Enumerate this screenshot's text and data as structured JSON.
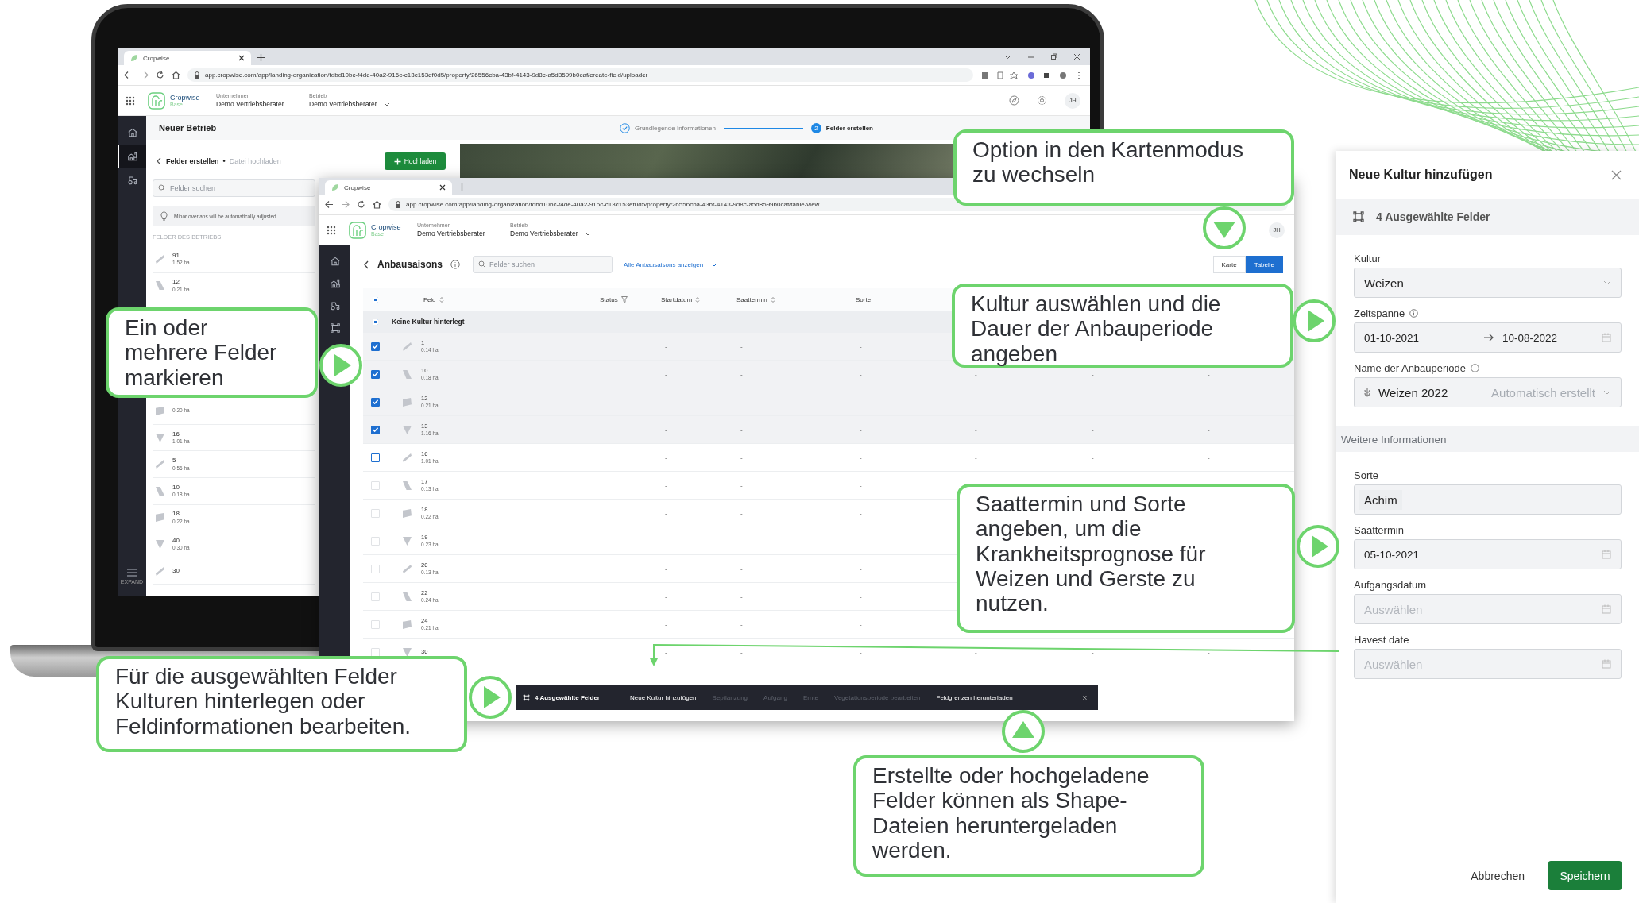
{
  "back_window": {
    "tab": {
      "title": "Cropwise"
    },
    "url": "app.cropwise.com/app/landing-organization/fdbd10bc-f4de-40a2-916c-c13c153ef0d5/property/26556cba-43bf-4143-9d8c-a5d8599b0caf/create-field/uploader",
    "header": {
      "brand": "Cropwise",
      "brand_sub": "Base",
      "company_label": "Unternehmen",
      "company": "Demo Vertriebsberater",
      "farm_label": "Betrieb",
      "farm": "Demo Vertriebsberater",
      "avatar": "JH"
    },
    "sidebar": [
      {
        "selected": false
      },
      {
        "selected": true
      },
      {
        "selected": false
      }
    ],
    "expand_label": "EXPAND",
    "title": "Neuer Betrieb",
    "steps": [
      {
        "label": "Grundlegende Informationen",
        "done": true
      },
      {
        "number": "2",
        "label": "Felder erstellen",
        "done": false
      }
    ],
    "panel": {
      "title": "Felder erstellen",
      "separator": "•",
      "subtitle": "Datei hochladen",
      "upload_button": "Hochladen",
      "search_placeholder": "Felder suchen",
      "hint": "Minor overlaps will be automatically adjusted.",
      "list_heading": "FELDER DES BETRIEBS",
      "fields": [
        {
          "name": "91",
          "area": "1.52 ha"
        },
        {
          "name": "12",
          "area": "0.21 ha"
        },
        {
          "area": "0.20 ha"
        },
        {
          "name": "16",
          "area": "1.01 ha"
        },
        {
          "name": "5",
          "area": "0.56 ha"
        },
        {
          "name": "10",
          "area": "0.18 ha"
        },
        {
          "name": "18",
          "area": "0.22 ha"
        },
        {
          "name": "40",
          "area": "0.30 ha"
        },
        {
          "name": "30"
        }
      ]
    }
  },
  "front_window": {
    "tab": {
      "title": "Cropwise"
    },
    "url": "app.cropwise.com/app/landing-organization/fdbd10bc-f4de-40a2-916c-c13c153ef0d5/property/26556cba-43bf-4143-9d8c-a5d8599b0caf/table-view",
    "header": {
      "brand": "Cropwise",
      "brand_sub": "Base",
      "company_label": "Unternehmen",
      "company": "Demo Vertriebsberater",
      "farm_label": "Betrieb",
      "farm": "Demo Vertriebsberater",
      "avatar": "JH"
    },
    "title": "Anbausaisons",
    "search_placeholder": "Felder suchen",
    "filter_link": "Alle Anbausaisons anzeigen",
    "view_toggle": [
      {
        "label": "Karte",
        "selected": false
      },
      {
        "label": "Tabelle",
        "selected": true
      }
    ],
    "table": {
      "indeterminate": true,
      "columns": [
        {
          "label": "Feld",
          "kind": "sort"
        },
        {
          "label": "Status",
          "kind": "filter"
        },
        {
          "label": "Startdatum",
          "kind": "sort"
        },
        {
          "label": "Saattermin",
          "kind": "sort"
        },
        {
          "label": "Sorte",
          "kind": "plain"
        }
      ],
      "group": {
        "label": "Keine Kultur hinterlegt",
        "indeterminate": true
      },
      "rows": [
        {
          "name": "1",
          "area": "0.14 ha",
          "checked": true,
          "disabled": false,
          "cells": [
            "",
            "",
            "-",
            "-",
            "-"
          ]
        },
        {
          "name": "10",
          "area": "0.18 ha",
          "checked": true,
          "disabled": false,
          "cells": [
            "",
            "",
            "-",
            "-",
            "-",
            "-",
            "-",
            "-"
          ]
        },
        {
          "name": "12",
          "area": "0.21 ha",
          "checked": true,
          "disabled": false,
          "cells": [
            "",
            "",
            "-",
            "-",
            "-",
            "-",
            "-",
            "-"
          ]
        },
        {
          "name": "13",
          "area": "1.16 ha",
          "checked": true,
          "disabled": false,
          "cells": [
            "",
            "",
            "-",
            "-",
            "-",
            "-",
            "-",
            "-"
          ]
        },
        {
          "name": "16",
          "area": "1.01 ha",
          "checked": false,
          "disabled": false,
          "cells": [
            "",
            "",
            "-",
            "-",
            "-",
            "-",
            "-",
            "-"
          ]
        },
        {
          "name": "17",
          "area": "0.13 ha",
          "checked": false,
          "disabled": true,
          "cells": [
            "",
            "",
            "-",
            "-",
            "-"
          ]
        },
        {
          "name": "18",
          "area": "0.22 ha",
          "checked": false,
          "disabled": true,
          "cells": [
            "",
            "",
            "-",
            "-",
            "-"
          ]
        },
        {
          "name": "19",
          "area": "0.23 ha",
          "checked": false,
          "disabled": true,
          "cells": [
            "",
            "",
            "-",
            "-",
            "-"
          ]
        },
        {
          "name": "20",
          "area": "0.13 ha",
          "checked": false,
          "disabled": true,
          "cells": [
            "",
            "",
            "-",
            "-",
            "-"
          ]
        },
        {
          "name": "22",
          "area": "0.24 ha",
          "checked": false,
          "disabled": true,
          "cells": [
            "",
            "",
            "-",
            "-",
            "-"
          ]
        },
        {
          "name": "24",
          "area": "0.21 ha",
          "checked": false,
          "disabled": true,
          "cells": [
            "",
            "",
            "-",
            "-",
            "-"
          ]
        },
        {
          "name": "30",
          "checked": false,
          "disabled": true,
          "cells": [
            "",
            "",
            "-",
            "-",
            "-",
            "-",
            "-",
            "-"
          ]
        }
      ]
    },
    "action_bar": {
      "count": "4 Ausgewählte Felder",
      "actions": [
        {
          "label": "Neue Kultur hinzufügen",
          "disabled": false
        },
        {
          "label": "Bepflanzung",
          "disabled": true
        },
        {
          "label": "Aufgang",
          "disabled": true
        },
        {
          "label": "Ernte",
          "disabled": true
        },
        {
          "label": "Vegetationsperiode bearbeiten",
          "disabled": true
        },
        {
          "label": "Feldgrenzen herunterladen",
          "disabled": false
        }
      ],
      "close": "X"
    }
  },
  "dialog": {
    "title": "Neue Kultur hinzufügen",
    "selection": "4 Ausgewählte Felder",
    "fields": [
      {
        "kind": "select",
        "label": "Kultur",
        "value": "Weizen"
      },
      {
        "kind": "range",
        "label": "Zeitspanne",
        "info": true,
        "start": "01-10-2021",
        "end": "10-08-2022"
      },
      {
        "kind": "name",
        "label": "Name der Anbauperiode",
        "info": true,
        "value": "Weizen 2022",
        "hint": "Automatisch erstellt"
      }
    ],
    "section": "Weitere Informationen",
    "more_fields": [
      {
        "kind": "text",
        "label": "Sorte",
        "value": "Achim"
      },
      {
        "kind": "date",
        "label": "Saattermin",
        "value": "05-10-2021"
      },
      {
        "kind": "date",
        "label": "Aufgangsdatum",
        "placeholder": "Auswählen"
      },
      {
        "kind": "date",
        "label": "Havest date",
        "placeholder": "Auswählen"
      }
    ],
    "cancel": "Abbrechen",
    "save": "Speichern"
  },
  "callouts": [
    {
      "text": "Option in den Kartenmodus zu wechseln"
    },
    {
      "text": "Ein oder mehrere Felder markieren"
    },
    {
      "text": "Kultur auswählen und die Dauer der Anbauperiode angeben"
    },
    {
      "text": "Saattermin und Sorte angeben, um die Krankheitsprognose für Weizen und Gerste zu nutzen."
    },
    {
      "text": "Für die ausgewählten Felder Kulturen hinterlegen oder Feldinformationen bearbeiten."
    },
    {
      "text": "Erstellte oder hochgeladene Felder können als Shape-Dateien heruntergeladen werden."
    }
  ]
}
